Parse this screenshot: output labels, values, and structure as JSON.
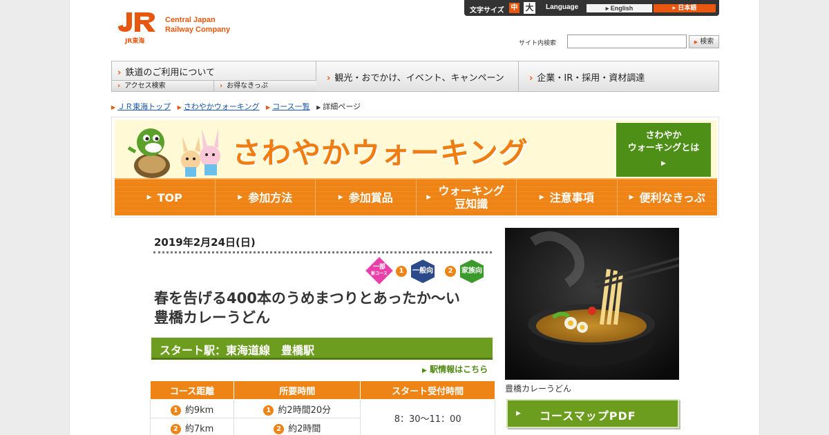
{
  "header": {
    "logo_sub": "JR東海",
    "company_name_line1": "Central Japan",
    "company_name_line2": "Railway Company"
  },
  "utilbar": {
    "font_size_label": "文字サイズ",
    "size_medium": "中",
    "size_large": "大",
    "language_label": "Language",
    "english": "English",
    "japanese": "日本語"
  },
  "search": {
    "label": "サイト内検索",
    "value": "",
    "button": "検索"
  },
  "mainnav": {
    "rail_use": "鉄道のご利用について",
    "access_search": "アクセス検索",
    "deal_tickets": "お得なきっぷ",
    "sightseeing": "観光・おでかけ、イベント、キャンペーン",
    "corporate": "企業・IR・採用・資材調達"
  },
  "breadcrumb": {
    "top": "ＪＲ東海トップ",
    "walking": "さわやかウォーキング",
    "course_list": "コース一覧",
    "current": "詳細ページ"
  },
  "banner": {
    "title": "さわやかウォーキング",
    "about_line1": "さわやか",
    "about_line2": "ウォーキングとは",
    "nav": [
      {
        "label": "TOP"
      },
      {
        "label": "参加方法"
      },
      {
        "label": "参加賞品"
      },
      {
        "label": "ウォーキング豆知識"
      },
      {
        "label": "注意事項"
      },
      {
        "label": "便利なきっぷ"
      }
    ]
  },
  "course": {
    "date": "2019年2月24日(日)",
    "badge_partial_line1": "一部",
    "badge_partial_line2": "新コース",
    "badge_num1": "1",
    "badge_general": "一般向",
    "badge_num2": "2",
    "badge_family": "家族向",
    "title_line1": "春を告げる400本のうめまつりとあったか～い",
    "title_line2": "豊橋カレーうどん",
    "start_station": "スタート駅：東海道線　豊橋駅",
    "station_info_link": "駅情報はこちら",
    "colors": {
      "accent": "#ef8416",
      "green": "#6d9d1e",
      "pink": "#e83fa8",
      "navy": "#2a4a8a",
      "family_green": "#3a9a2a"
    }
  },
  "table": {
    "headers": [
      "コース距離",
      "所要時間",
      "スタート受付時間"
    ],
    "rows": [
      {
        "num": "1",
        "distance": "約9km",
        "num2": "1",
        "duration": "約2時間20分"
      },
      {
        "num": "2",
        "distance": "約7km",
        "num2": "2",
        "duration": "約2時間"
      }
    ],
    "reception": "8：30～11：00"
  },
  "side": {
    "photo_caption": "豊橋カレーうどん",
    "pdf_button": "コースマップPDF"
  }
}
